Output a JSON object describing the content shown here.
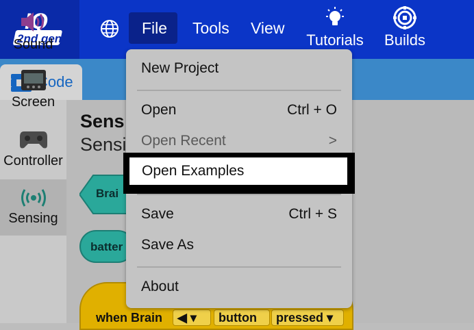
{
  "header": {
    "logo": {
      "line1": "IQ",
      "line2": "2nd gen"
    },
    "menus": {
      "file": "File",
      "tools": "Tools",
      "view": "View"
    },
    "tutorials": "Tutorials",
    "builds": "Builds"
  },
  "code_tab": {
    "label": "Code"
  },
  "categories": {
    "sound": "Sound",
    "screen": "Screen",
    "controller": "Controller",
    "sensing": "Sensing"
  },
  "workspace": {
    "title": "Sens",
    "subtitle": "Sensi",
    "blocks": {
      "brain": "Brai",
      "battery": "batter",
      "hat_text": "when Brain",
      "arrow_slot": "◀ ▾",
      "button_slot": "button",
      "pressed_slot": "pressed ▾"
    }
  },
  "file_menu": {
    "new_project": "New Project",
    "open": "Open",
    "open_shortcut": "Ctrl + O",
    "open_recent": "Open Recent",
    "open_recent_arrow": ">",
    "open_examples": "Open Examples",
    "save": "Save",
    "save_shortcut": "Ctrl + S",
    "save_as": "Save As",
    "about": "About"
  },
  "colors": {
    "topbar": "#0b35c7",
    "subbar": "#3b88c8",
    "menu_bg": "#c4c4c4",
    "sensing_block": "#2aa89a",
    "event_block": "#e0b000"
  }
}
